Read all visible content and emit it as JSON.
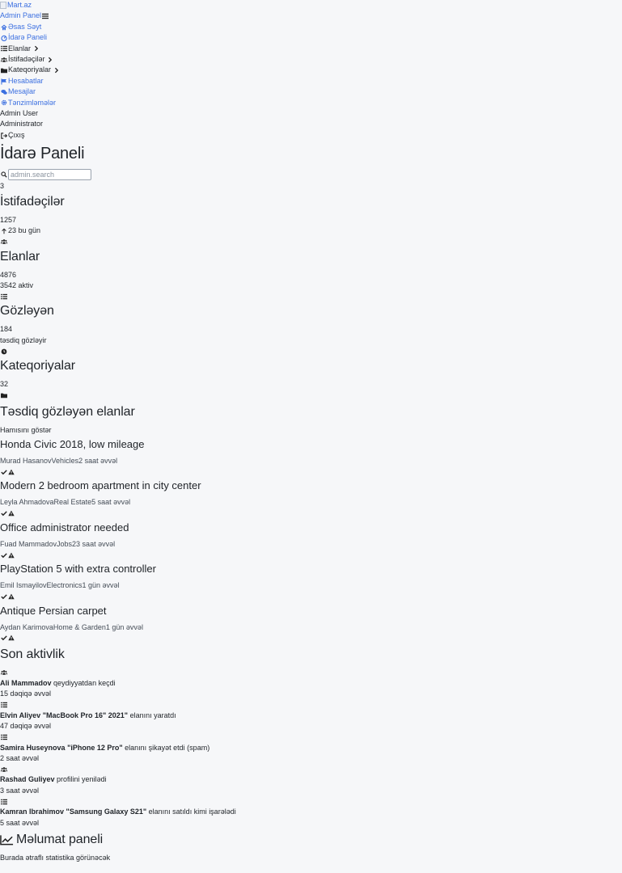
{
  "sidebar": {
    "logo_alt": "Mart.az",
    "panel_title": "Admin Panel",
    "nav": [
      {
        "label": "Əsas Səyt",
        "icon": "home-icon",
        "link": true,
        "chevron": false
      },
      {
        "label": "İdarə Paneli",
        "icon": "dashboard-icon",
        "link": true,
        "chevron": false
      },
      {
        "label": "Elanlar",
        "icon": "list-icon",
        "link": false,
        "chevron": true
      },
      {
        "label": "İstifadəçilər",
        "icon": "users-icon",
        "link": false,
        "chevron": true
      },
      {
        "label": "Kateqoriyalar",
        "icon": "folder-icon",
        "link": false,
        "chevron": true
      },
      {
        "label": "Hesabatlar",
        "icon": "flag-icon",
        "link": true,
        "chevron": false
      },
      {
        "label": "Mesajlar",
        "icon": "comments-icon",
        "link": true,
        "chevron": false
      },
      {
        "label": "Tənzimləmələr",
        "icon": "gear-icon",
        "link": true,
        "chevron": false
      }
    ],
    "user_name": "Admin User",
    "user_role": "Administrator",
    "logout_label": "Çıxış"
  },
  "header": {
    "title": "İdarə Paneli",
    "search_placeholder": "admin.search",
    "notification_count": "3"
  },
  "stats": [
    {
      "title": "İstifadəçilər",
      "value": "1257",
      "sub": "23 bu gün",
      "sub_icon": "arrow-up-icon",
      "icon": "users-icon"
    },
    {
      "title": "Elanlar",
      "value": "4876",
      "sub": "3542 aktiv",
      "sub_icon": "",
      "icon": "list-icon"
    },
    {
      "title": "Gözləyən",
      "value": "184",
      "sub": "təsdiq gözləyir",
      "sub_icon": "",
      "icon": "clock-icon"
    },
    {
      "title": "Kateqoriyalar",
      "value": "32",
      "sub": "",
      "sub_icon": "",
      "icon": "folder-icon"
    }
  ],
  "pending": {
    "title": "Təsdiq gözləyən elanlar",
    "show_all": "Hamısını göstər",
    "items": [
      {
        "title": "Honda Civic 2018, low mileage",
        "user": "Murad Hasanov",
        "category": "Vehicles",
        "time": "2 saat əvvəl"
      },
      {
        "title": "Modern 2 bedroom apartment in city center",
        "user": "Leyla Ahmadova",
        "category": "Real Estate",
        "time": "5 saat əvvəl"
      },
      {
        "title": "Office administrator needed",
        "user": "Fuad Mammadov",
        "category": "Jobs",
        "time": "23 saat əvvəl"
      },
      {
        "title": "PlayStation 5 with extra controller",
        "user": "Emil Ismayilov",
        "category": "Electronics",
        "time": "1 gün əvvəl"
      },
      {
        "title": "Antique Persian carpet",
        "user": "Aydan Karimova",
        "category": "Home & Garden",
        "time": "1 gün əvvəl"
      }
    ]
  },
  "activity": {
    "title": "Son aktivlik",
    "items": [
      {
        "icon": "users-icon",
        "name": "Ali Mammadov",
        "object": "",
        "text": "qeydiyyatdan keçdi",
        "time": "15 dəqiqə əvvəl"
      },
      {
        "icon": "list-icon",
        "name": "Elvin Aliyev",
        "object": "\"MacBook Pro 16\" 2021\"",
        "text": "elanını yaratdı",
        "time": "47 dəqiqə əvvəl"
      },
      {
        "icon": "list-icon",
        "name": "Samira Huseynova",
        "object": "\"iPhone 12 Pro\"",
        "text": "elanını şikayət etdi (spam)",
        "time": "2 saat əvvəl"
      },
      {
        "icon": "users-icon",
        "name": "Rashad Guliyev",
        "object": "",
        "text": "profilini yenilədi",
        "time": "3 saat əvvəl"
      },
      {
        "icon": "list-icon",
        "name": "Kamran Ibrahimov",
        "object": "\"Samsung Galaxy S21\"",
        "text": "elanını satıldı kimi işarələdi",
        "time": "5 saat əvvəl"
      }
    ]
  },
  "info_panel": {
    "title": "Məlumat paneli",
    "text": "Burada ətraflı statistika görünəcək"
  }
}
